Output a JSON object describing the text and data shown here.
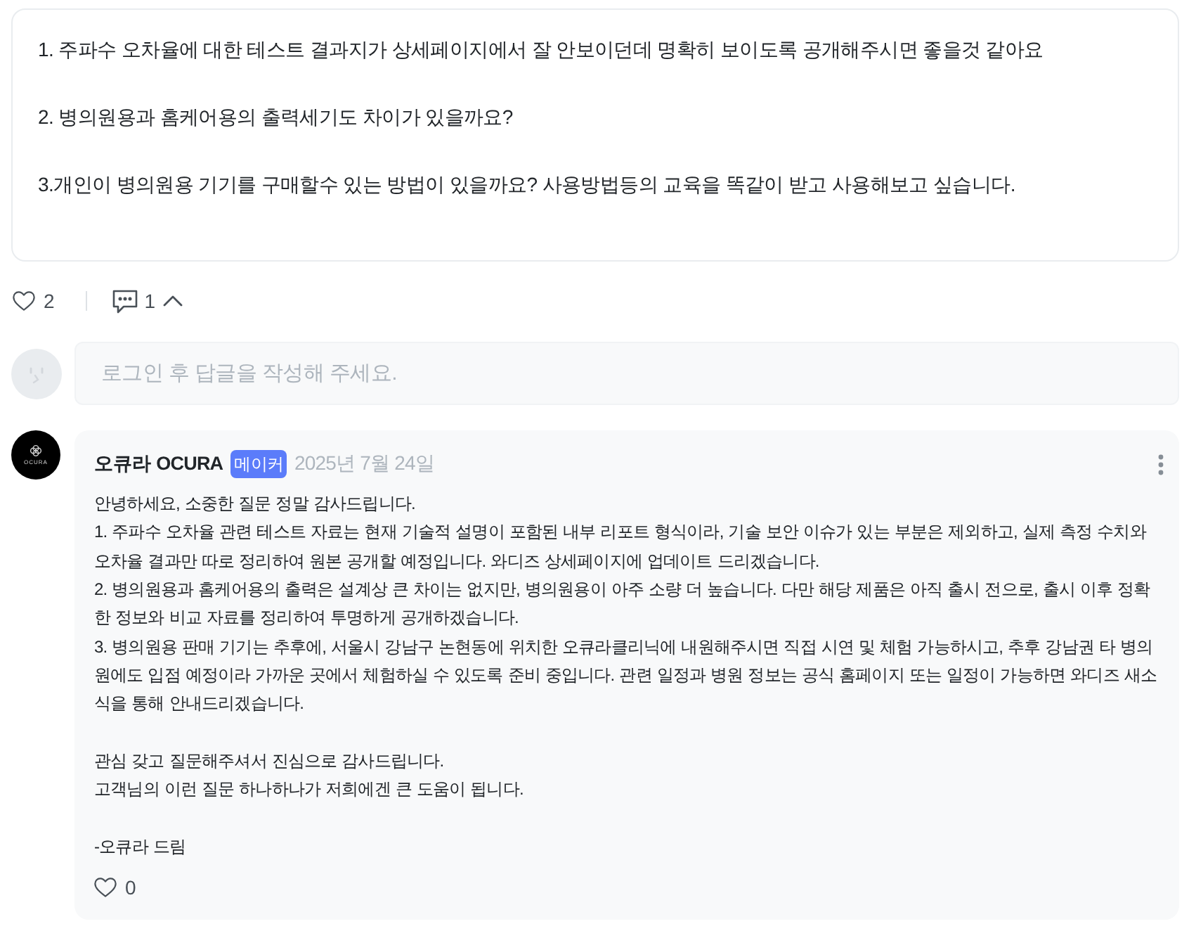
{
  "question": {
    "paragraphs": [
      "1. 주파수 오차율에 대한 테스트 결과지가 상세페이지에서 잘 안보이던데 명확히 보이도록 공개해주시면 좋을것 같아요",
      "2. 병의원용과 홈케어용의 출력세기도 차이가 있을까요?",
      "3.개인이 병의원용 기기를 구매할수 있는 방법이 있을까요? 사용방법등의 교육을 똑같이 받고 사용해보고 싶습니다."
    ]
  },
  "question_actions": {
    "likes": "2",
    "comments": "1",
    "comments_expanded": true
  },
  "reply_box": {
    "placeholder": "로그인 후 답글을 작성해 주세요."
  },
  "comments": [
    {
      "author": "오큐라 OCURA",
      "avatar_text": "OCURA",
      "badge": "메이커",
      "date": "2025년 7월 24일",
      "body": [
        {
          "lines": [
            "안녕하세요, 소중한 질문 정말 감사드립니다.",
            "1. 주파수 오차율 관련 테스트 자료는 현재 기술적 설명이 포함된 내부 리포트 형식이라, 기술 보안 이슈가 있는 부분은 제외하고, 실제 측정 수치와 오차율 결과만 따로 정리하여 원본 공개할 예정입니다. 와디즈 상세페이지에 업데이트 드리겠습니다.",
            "2. 병의원용과 홈케어용의 출력은 설계상 큰 차이는 없지만, 병의원용이 아주 소량 더 높습니다. 다만 해당 제품은 아직 출시 전으로, 출시 이후 정확한 정보와 비교 자료를 정리하여 투명하게 공개하겠습니다.",
            "3. 병의원용 판매 기기는 추후에, 서울시 강남구 논현동에 위치한 오큐라클리닉에 내원해주시면 직접 시연 및 체험 가능하시고, 추후 강남권 타 병의원에도 입점 예정이라 가까운 곳에서 체험하실 수 있도록 준비 중입니다. 관련 일정과 병원 정보는 공식 홈페이지 또는 일정이 가능하면 와디즈 새소식을 통해 안내드리겠습니다."
          ]
        },
        {
          "lines": [
            "관심 갖고 질문해주셔서 진심으로 감사드립니다.",
            "고객님의 이런 질문 하나하나가 저희에겐 큰 도움이 됩니다."
          ]
        },
        {
          "lines": [
            "-오큐라 드림"
          ]
        }
      ],
      "likes": "0"
    }
  ]
}
